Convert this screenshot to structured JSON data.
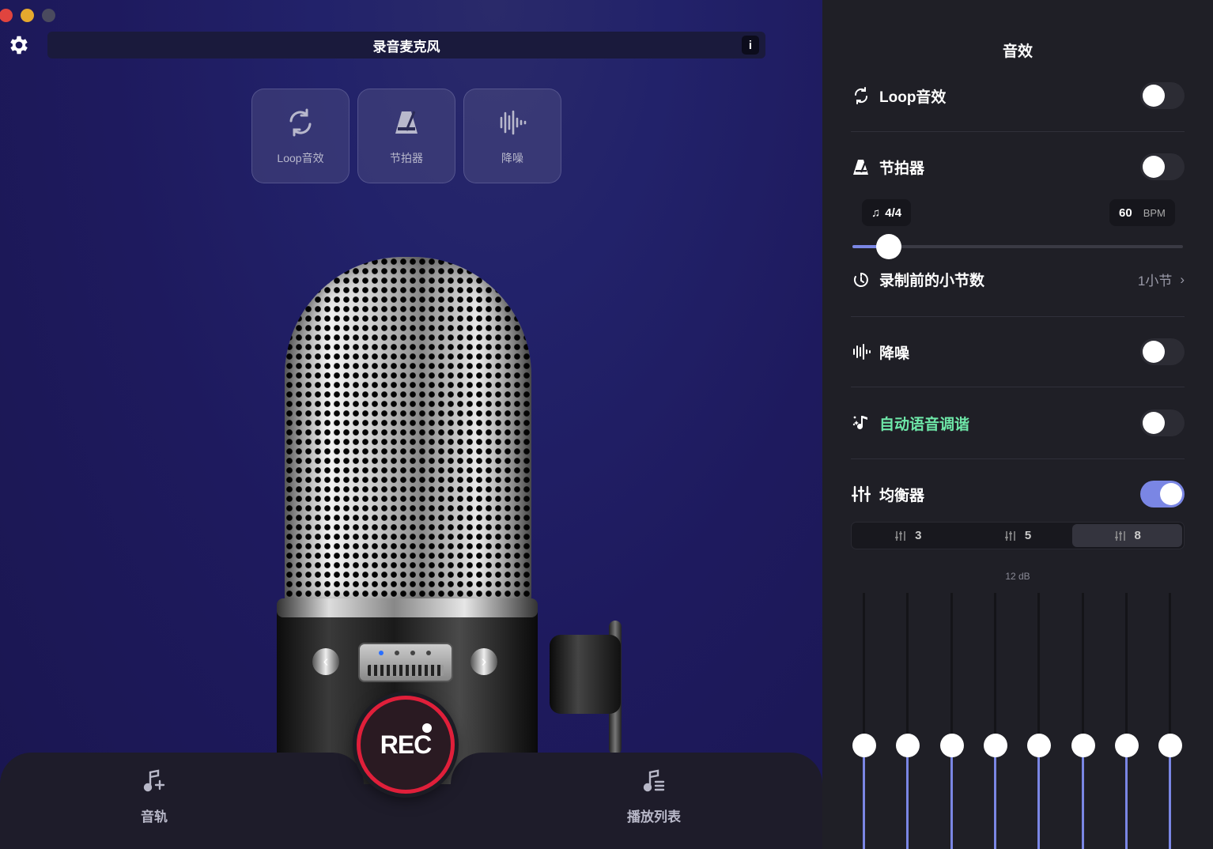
{
  "window": {
    "title": "录音麦克风",
    "info_label": "i"
  },
  "quick_buttons": [
    {
      "label": "Loop音效",
      "icon": "loop-icon"
    },
    {
      "label": "节拍器",
      "icon": "metronome-icon"
    },
    {
      "label": "降噪",
      "icon": "waveform-icon"
    }
  ],
  "record": {
    "label": "REC",
    "accent": "#e01f3a"
  },
  "bottom_nav": {
    "tracks_label": "音轨",
    "playlist_label": "播放列表"
  },
  "panel": {
    "title": "音效",
    "loop": {
      "label": "Loop音效",
      "enabled": false
    },
    "metronome": {
      "label": "节拍器",
      "enabled": false,
      "time_signature": "4/4",
      "bpm": "60",
      "bpm_unit": "BPM",
      "tempo_level": 0.11
    },
    "count_in": {
      "label": "录制前的小节数",
      "value": "1小节"
    },
    "noise": {
      "label": "降噪",
      "enabled": false
    },
    "autotune": {
      "label": "自动语音调谐",
      "enabled": false,
      "color": "#6ee7a8"
    },
    "equalizer": {
      "label": "均衡器",
      "enabled": true,
      "band_options": [
        "3",
        "5",
        "8"
      ],
      "selected_bands": "8",
      "db_label": "12 dB",
      "band_levels": [
        0.45,
        0.45,
        0.45,
        0.45,
        0.45,
        0.45,
        0.45,
        0.45
      ]
    },
    "accent": "#7a86e4"
  }
}
